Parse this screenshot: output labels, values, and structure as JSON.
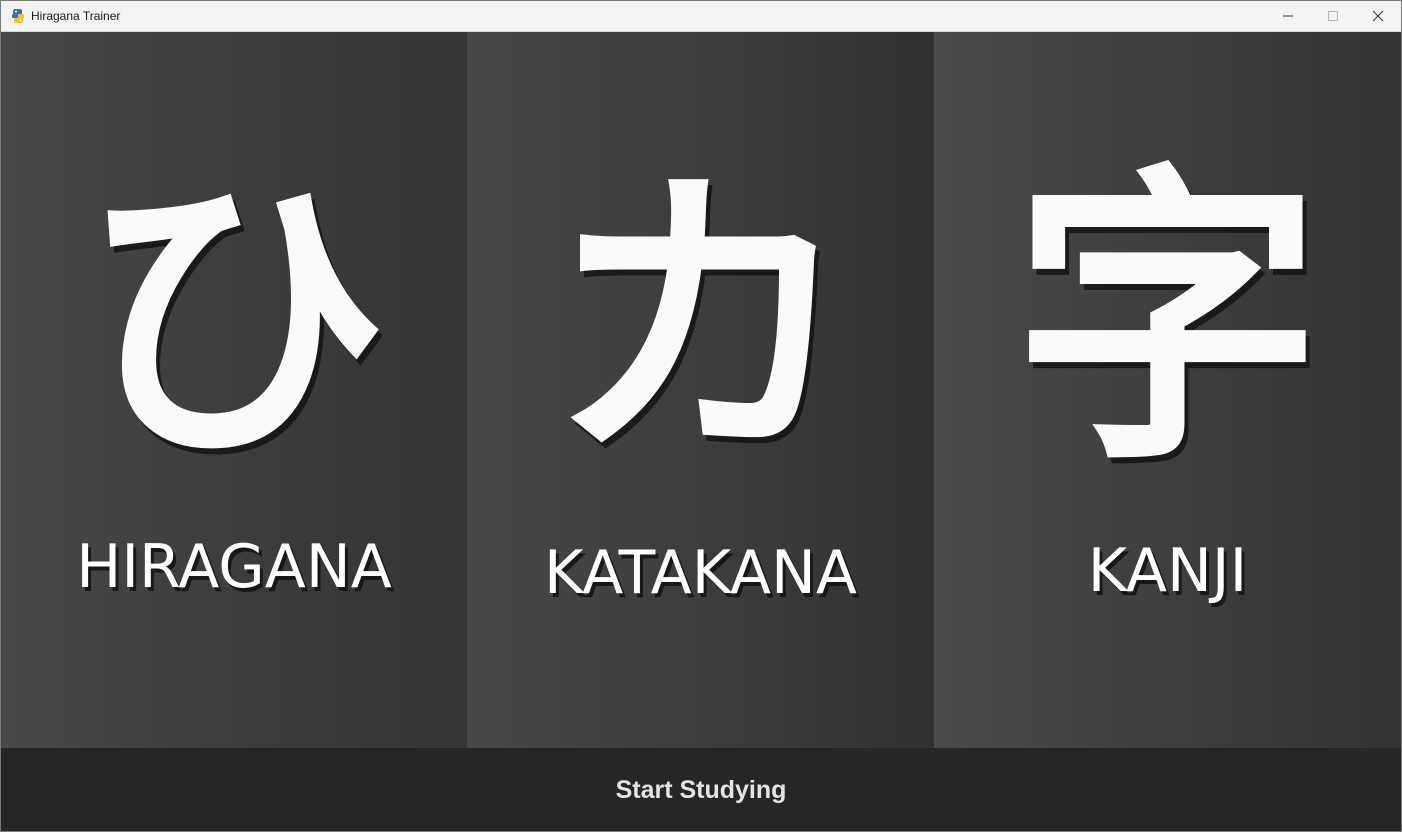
{
  "window": {
    "title": "Hiragana Trainer",
    "app_icon": "python-icon",
    "controls": {
      "minimize_icon": "minimize-icon",
      "maximize_icon": "maximize-icon",
      "close_icon": "close-icon"
    }
  },
  "panels": [
    {
      "glyph": "ひ",
      "label": "HIRAGANA"
    },
    {
      "glyph": "カ",
      "label": "KATAKANA"
    },
    {
      "glyph": "字",
      "label": "KANJI"
    }
  ],
  "footer": {
    "button_label": "Start Studying"
  },
  "colors": {
    "panel_bg": "#3c3c3c",
    "footer_bg": "#262626",
    "text": "#ffffff",
    "titlebar_bg": "#f3f3f3"
  }
}
